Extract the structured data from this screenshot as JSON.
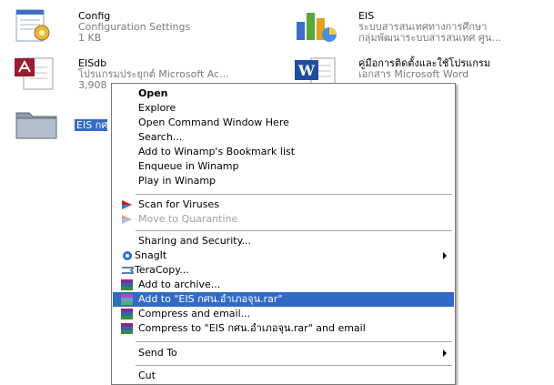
{
  "files": [
    {
      "name": "Config",
      "line2": "Configuration Settings",
      "line3": "1 KB",
      "icon": "config-settings-icon"
    },
    {
      "name": "EIS",
      "line2": "ระบบสารสนเทศทางการศึกษา",
      "line3": "กลุ่มพัฒนาระบบสารสนเทศ ศูน...",
      "icon": "bar-chart-icon"
    },
    {
      "name": "EISdb",
      "line2": "โปรแกรมประยุกต์ Microsoft Ac...",
      "line3": "3,908",
      "icon": "access-database-icon"
    },
    {
      "name": "คู่มือการติดตั้งและใช้โปรแกรม",
      "line2": "เอกสาร Microsoft Word",
      "line3": "",
      "icon": "word-document-icon"
    }
  ],
  "selected_folder": {
    "label": "EIS กศ",
    "icon": "folder-icon"
  },
  "context_menu": {
    "open": "Open",
    "explore": "Explore",
    "open_cmd": "Open Command Window Here",
    "search": "Search...",
    "winamp_bookmark": "Add to Winamp's Bookmark list",
    "enqueue_winamp": "Enqueue in Winamp",
    "play_winamp": "Play in Winamp",
    "scan_viruses": "Scan for Viruses",
    "move_quarantine": "Move to Quarantine",
    "sharing_security": "Sharing and Security...",
    "snagit": "SnagIt",
    "teracopy": "TeraCopy...",
    "add_archive": "Add to archive...",
    "add_to_rar": "Add to \"EIS กศน.อำเภอจุน.rar\"",
    "compress_email": "Compress and email...",
    "compress_rar_email": "Compress to \"EIS กศน.อำเภอจุน.rar\" and email",
    "send_to": "Send To",
    "cut": "Cut"
  },
  "colors": {
    "highlight": "#316ac5",
    "disabled_text": "#a0a0a0",
    "subtext": "#7a7a7a"
  }
}
